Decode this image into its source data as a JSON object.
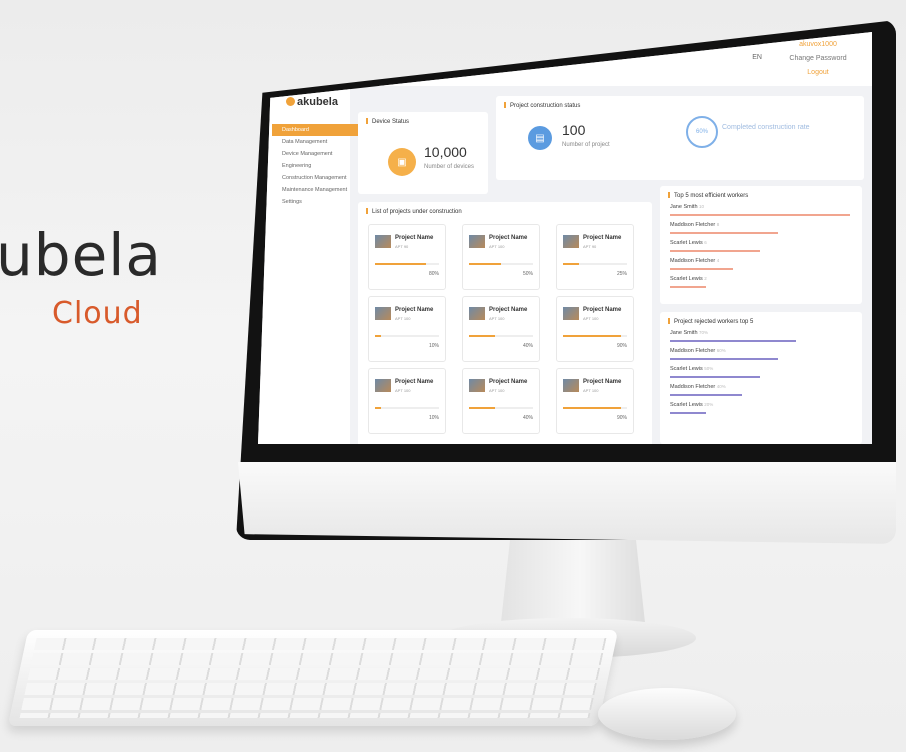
{
  "brand": {
    "name": "ubela",
    "sub": "Cloud"
  },
  "app": {
    "logo": "akubela"
  },
  "topbar": {
    "lang": "EN",
    "user": "akuvox1000",
    "change_password": "Change Password",
    "logout": "Logout"
  },
  "sidebar": {
    "items": [
      {
        "label": "Dashboard",
        "active": true
      },
      {
        "label": "Data Management",
        "active": false
      },
      {
        "label": "Device Management",
        "active": false
      },
      {
        "label": "Engineering",
        "active": false
      },
      {
        "label": "Construction Management",
        "active": false
      },
      {
        "label": "Maintenance Management",
        "active": false
      },
      {
        "label": "Settings",
        "active": false
      }
    ]
  },
  "device_status": {
    "title": "Device Status",
    "count": "10,000",
    "caption": "Number of devices"
  },
  "construction_status": {
    "title": "Project construction status",
    "count": "100",
    "caption": "Number of project",
    "rate": "60%",
    "rate_label": "Completed construction rate"
  },
  "projects": {
    "title": "List of projects under construction",
    "items": [
      {
        "name": "Project Name",
        "code": "APT 90",
        "progress": 0.8,
        "pct": "80%"
      },
      {
        "name": "Project Name",
        "code": "APT 100",
        "progress": 0.5,
        "pct": "50%"
      },
      {
        "name": "Project Name",
        "code": "APT 90",
        "progress": 0.25,
        "pct": "25%"
      },
      {
        "name": "Project Name",
        "code": "APT 100",
        "progress": 0.1,
        "pct": "10%"
      },
      {
        "name": "Project Name",
        "code": "APT 100",
        "progress": 0.4,
        "pct": "40%"
      },
      {
        "name": "Project Name",
        "code": "APT 100",
        "progress": 0.9,
        "pct": "90%"
      },
      {
        "name": "Project Name",
        "code": "APT 100",
        "progress": 0.1,
        "pct": "10%"
      },
      {
        "name": "Project Name",
        "code": "APT 100",
        "progress": 0.4,
        "pct": "40%"
      },
      {
        "name": "Project Name",
        "code": "APT 100",
        "progress": 0.9,
        "pct": "90%"
      }
    ]
  },
  "top_workers": {
    "title": "Top 5 most efficient workers",
    "color": "#f1a58f",
    "items": [
      {
        "name": "Jane Smith",
        "value": "10",
        "level": 1.0
      },
      {
        "name": "Maddison Fletcher",
        "value": "8",
        "level": 0.6
      },
      {
        "name": "Scarlet Lewis",
        "value": "6",
        "level": 0.5
      },
      {
        "name": "Maddison Fletcher",
        "value": "4",
        "level": 0.35
      },
      {
        "name": "Scarlet Lewis",
        "value": "2",
        "level": 0.2
      }
    ]
  },
  "rejected_workers": {
    "title": "Project rejected workers top 5",
    "color": "#8f88cf",
    "items": [
      {
        "name": "Jane Smith",
        "value": "70%",
        "level": 0.7
      },
      {
        "name": "Maddison Fletcher",
        "value": "60%",
        "level": 0.6
      },
      {
        "name": "Scarlet Lewis",
        "value": "50%",
        "level": 0.5
      },
      {
        "name": "Maddison Fletcher",
        "value": "40%",
        "level": 0.4
      },
      {
        "name": "Scarlet Lewis",
        "value": "20%",
        "level": 0.2
      }
    ]
  },
  "colors": {
    "accent": "#f0a23a",
    "brand_red": "#d85a2b"
  }
}
